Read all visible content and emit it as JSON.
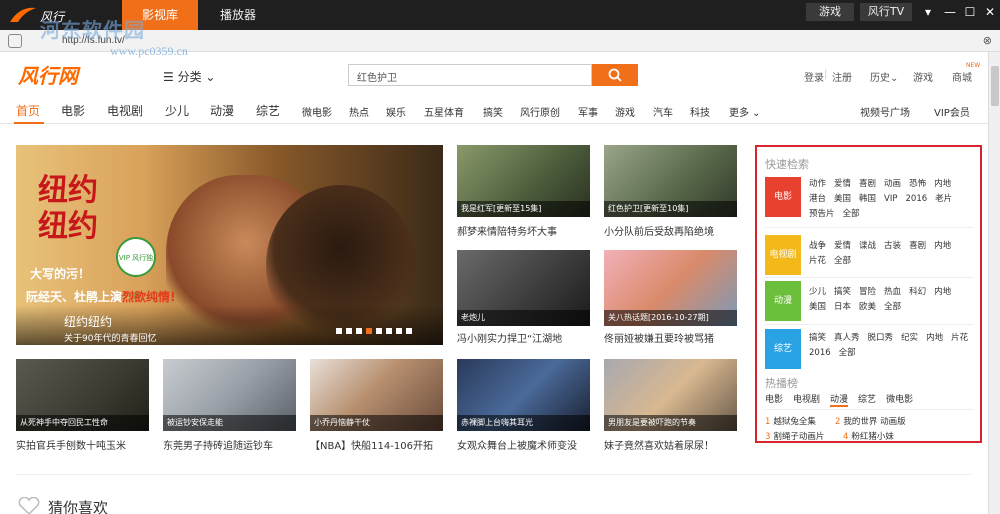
{
  "titlebar": {
    "app_name": "风行",
    "tabs": [
      "影视库",
      "播放器"
    ],
    "game_btn": "游戏",
    "tv_btn": "风行TV"
  },
  "watermark": {
    "text": "河东软件园",
    "url": "www.pc0359.cn"
  },
  "address": {
    "url": "http://fs.fun.tv/"
  },
  "header": {
    "logo": "风行网",
    "category": "☰ 分类 ⌄",
    "search_value": "红色护卫",
    "login": "登录",
    "register": "注册",
    "history": "历史⌄",
    "game": "游戏",
    "mall": "商城",
    "new_badge": "NEW"
  },
  "nav": {
    "primary": [
      "首页",
      "电影",
      "电视剧",
      "少儿",
      "动漫",
      "综艺"
    ],
    "secondary": [
      "微电影",
      "热点",
      "娱乐",
      "五星体育",
      "搞笑",
      "风行原创",
      "军事",
      "游戏",
      "汽车",
      "科技",
      "更多 ⌄"
    ],
    "right": [
      "视频号广场",
      "VIP会员"
    ]
  },
  "hero": {
    "big_title": "纽约纽约",
    "vip_badge": "VIP 风行独播",
    "tag1": "大写的污！",
    "tag2_prefix": "阮经天、杜鹃上演",
    "tag2_highlight": "烈欲纯情!",
    "caption_title": "纽约纽约",
    "caption_sub": "关于90年代的青春回忆",
    "dots": 8,
    "active_dot": 3
  },
  "thumbs": [
    {
      "cap": "我是红军[更新至15集]",
      "title": "郝梦来情陪特务坏大事"
    },
    {
      "cap": "红色护卫[更新至10集]",
      "title": "小分队前后受敌再陷绝境"
    },
    {
      "cap": "老炮儿",
      "title": "冯小刚实力捍卫“江湖地"
    },
    {
      "cap": "关八热话题[2016-10-27期]",
      "title": "佟丽娅被嫌丑要玲被骂猪"
    },
    {
      "cap": "从死神手中夺回民工性命",
      "title": "实拍官兵手刨数十吨玉米"
    },
    {
      "cap": "被运钞安保走能",
      "title": "东莞男子持砖追随运钞车"
    },
    {
      "cap": "小乔丹恼静干仗",
      "title": "【NBA】快船114-106开拓"
    },
    {
      "cap": "赤裸脚上台嗨其耳光",
      "title": "女观众舞台上被魔术师变没"
    },
    {
      "cap": "男朋友是要被吓跑的节奏",
      "title": "妹子竟然喜欢姑着尿尿！"
    }
  ],
  "sidebar": {
    "quick_title": "快速检索",
    "categories": [
      {
        "name": "电影",
        "color": "#e8412f",
        "tags": [
          "动作",
          "爱情",
          "喜剧",
          "动画",
          "恐怖",
          "内地",
          "港台",
          "美国",
          "韩国",
          "VIP",
          "2016",
          "老片",
          "预告片",
          "全部"
        ]
      },
      {
        "name": "电视剧",
        "color": "#f3b81a",
        "tags": [
          "战争",
          "爱情",
          "谍战",
          "古装",
          "喜剧",
          "内地",
          "片花",
          "全部"
        ]
      },
      {
        "name": "动漫",
        "color": "#6cbf3a",
        "tags": [
          "少儿",
          "搞笑",
          "冒险",
          "热血",
          "科幻",
          "内地",
          "美国",
          "日本",
          "欧美",
          "全部"
        ]
      },
      {
        "name": "综艺",
        "color": "#2aa3e4",
        "tags": [
          "搞笑",
          "真人秀",
          "脱口秀",
          "纪实",
          "内地",
          "片花",
          "2016",
          "全部"
        ]
      }
    ],
    "hot_title": "热播榜",
    "hot_tabs": [
      "电影",
      "电视剧",
      "动漫",
      "综艺",
      "微电影"
    ],
    "hot_active": 2,
    "hot_items": [
      {
        "num": "1",
        "text": "越狱兔全集"
      },
      {
        "num": "2",
        "text": "我的世界 动画版"
      },
      {
        "num": "3",
        "text": "割绳子动画片"
      },
      {
        "num": "4",
        "text": "粉红猪小妹"
      }
    ]
  },
  "guess": {
    "title": "猜你喜欢"
  }
}
